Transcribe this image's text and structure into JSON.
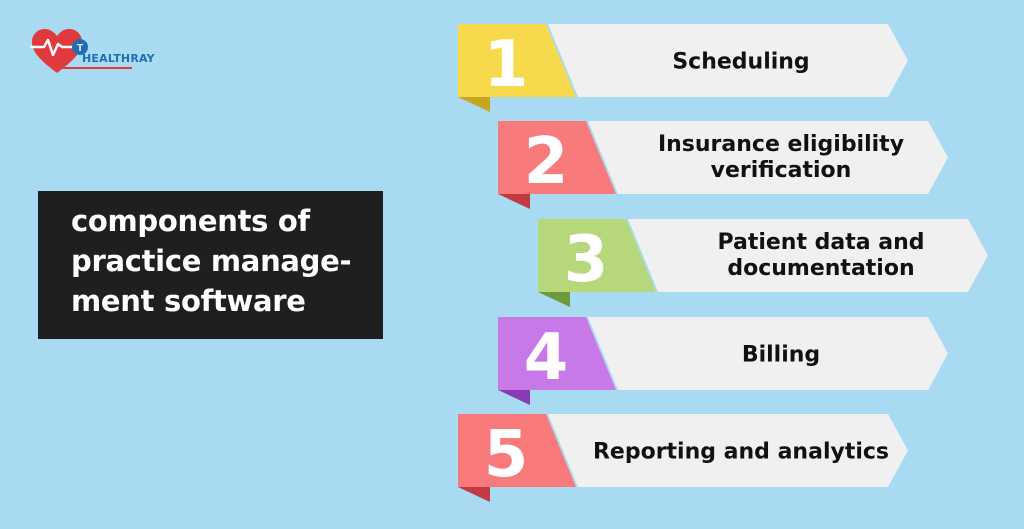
{
  "colors": {
    "background": "#a8daf2",
    "title_box": "#1f1f1f",
    "title_text": "#ffffff",
    "banner": "#f0f0f0",
    "banner_text": "#111111",
    "brand_red": "#e03a3f",
    "brand_blue": "#1f6fb5"
  },
  "brand": {
    "name": "HEALTHRAY",
    "logo_icon": "heart-pulse-icon"
  },
  "title": {
    "lines": [
      "components of",
      "practice manage-",
      "ment software"
    ]
  },
  "steps": [
    {
      "number": "1",
      "lines": [
        "Scheduling"
      ],
      "color": "#f7d94c",
      "fold_color": "#c7a51e"
    },
    {
      "number": "2",
      "lines": [
        "Insurance eligibility",
        "verification"
      ],
      "color": "#f87a7a",
      "fold_color": "#c23a42"
    },
    {
      "number": "3",
      "lines": [
        "Patient data and",
        "documentation"
      ],
      "color": "#b6d77a",
      "fold_color": "#6f9a3b"
    },
    {
      "number": "4",
      "lines": [
        "Billing"
      ],
      "color": "#c879e8",
      "fold_color": "#8a3bb3"
    },
    {
      "number": "5",
      "lines": [
        "Reporting and analytics"
      ],
      "color": "#f87a7a",
      "fold_color": "#c23a42"
    }
  ]
}
